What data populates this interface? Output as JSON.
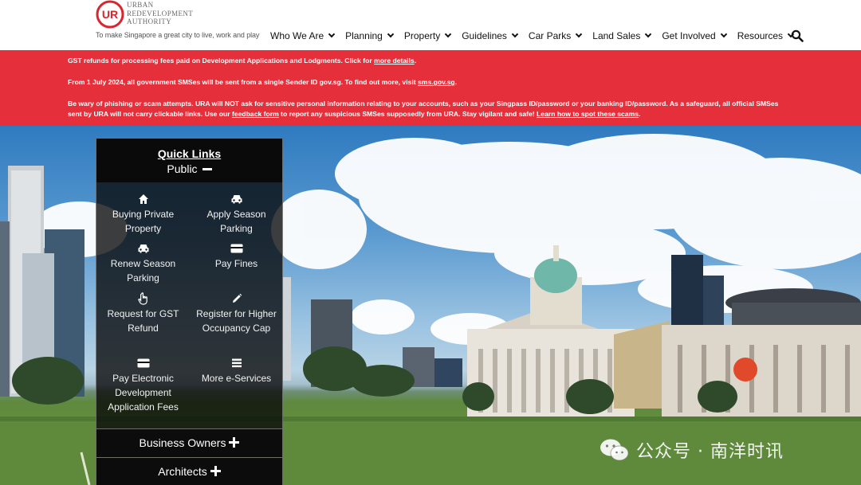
{
  "header": {
    "logo": {
      "line1": "Urban",
      "line2": "Redevelopment",
      "line3": "Authority"
    },
    "tagline": "To make Singapore a great city to live, work and play",
    "nav": [
      {
        "label": "Who We Are"
      },
      {
        "label": "Planning"
      },
      {
        "label": "Property"
      },
      {
        "label": "Guidelines"
      },
      {
        "label": "Car Parks"
      },
      {
        "label": "Land Sales"
      },
      {
        "label": "Get Involved"
      },
      {
        "label": "Resources"
      }
    ],
    "search_icon": "search-icon"
  },
  "alert": {
    "color": "#e5303c",
    "line1_text": "GST refunds for processing fees paid on Development Applications and Lodgments. Click for ",
    "line1_link": "more details",
    "line1_end": ".",
    "line2_text": "From 1 July 2024, all government SMSes will be sent from a single Sender ID gov.sg. To find out more, visit ",
    "line2_link": "sms.gov.sg",
    "line2_end": ".",
    "line3_text": "Be wary of phishing or scam attempts. URA will NOT ask for sensitive personal information relating to your accounts, such as your Singpass ID/password or your banking ID/password. As a safeguard, all official SMSes sent by URA will not carry clickable links. Use our ",
    "line3_link1": "feedback form",
    "line3_mid": " to report any suspicious SMSes supposedly from URA. Stay vigilant and safe! ",
    "line3_link2": "Learn how to spot these scams",
    "line3_end": "."
  },
  "quick_links": {
    "title": "Quick Links",
    "subtitle": "Public",
    "items": [
      {
        "label": "Buying Private Property",
        "icon": "home-icon"
      },
      {
        "label": "Apply Season Parking",
        "icon": "car-icon"
      },
      {
        "label": "Renew Season Parking",
        "icon": "car-icon"
      },
      {
        "label": "Pay Fines",
        "icon": "credit-card-icon"
      },
      {
        "label": "Request for GST Refund",
        "icon": "hand-pointer-icon"
      },
      {
        "label": "Register for Higher Occupancy Cap",
        "icon": "pencil-icon"
      },
      {
        "label": "Pay Electronic Development Application Fees",
        "icon": "credit-card-icon"
      },
      {
        "label": "More e-Services",
        "icon": "list-icon"
      }
    ],
    "sections": [
      {
        "label": "Business Owners"
      },
      {
        "label": "Architects"
      }
    ]
  },
  "watermark": {
    "text": "公众号 · 南洋时讯"
  }
}
